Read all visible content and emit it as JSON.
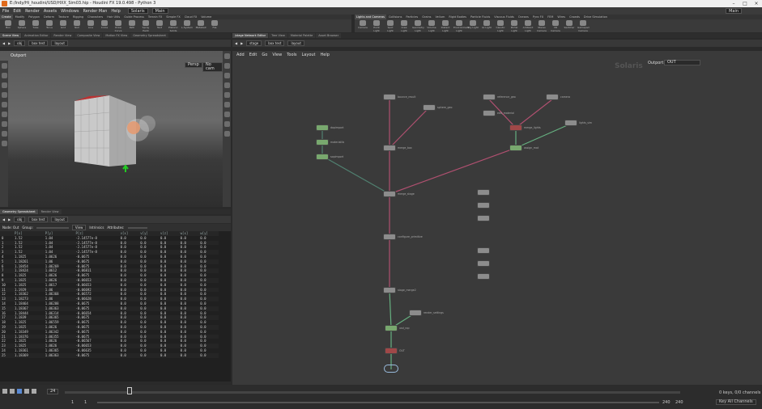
{
  "window": {
    "title": "E:/Indy/Hi_houdini/USD/HXX_Sim03.hip - Houdini FX 19.0.498 - Python 3"
  },
  "menu": [
    "File",
    "Edit",
    "Render",
    "Assets",
    "Windows",
    "Render Man",
    "Help"
  ],
  "desktop": {
    "left": "Solaris",
    "workspace": "Main",
    "right": "Main"
  },
  "shelf_tabs_left": [
    "Create",
    "Modify",
    "Polygon",
    "Deform",
    "Texture",
    "Rigging",
    "Characters",
    "Hair Utils",
    "Guide Process",
    "Terrain FX",
    "Simple FX",
    "Cloud FX",
    "Volume"
  ],
  "shelf_tabs_right": [
    "Lights and Cameras",
    "Collisions",
    "Particles",
    "Grains",
    "Vellum",
    "Rigid Bodies",
    "Particle Fluids",
    "Viscous Fluids",
    "Oceans",
    "Pyro FX",
    "FEM",
    "Wires",
    "Crowds",
    "Drive Simulation"
  ],
  "tools_left": [
    "Box",
    "Sphere",
    "Tube",
    "Torus",
    "Grid",
    "Null",
    "Line",
    "Circle",
    "Draw Curve",
    "Path",
    "Spray Paint",
    "Text",
    "Platonic Solids",
    "L-System",
    "Metaball",
    "File"
  ],
  "tools_right": [
    "Camera",
    "Point Light",
    "Spot Light",
    "Area Light",
    "Geometry Light",
    "Volume Light",
    "Distant Light",
    "Environment Light",
    "Sky Light",
    "GI Light",
    "Caustic Light",
    "Portal Light",
    "Ambient Light",
    "Stereo Camera",
    "VR Camera",
    "Switcher",
    "Gamepad Camera"
  ],
  "left_pane_tabs": [
    "Scene View",
    "Animation Editor",
    "Render View",
    "Composite View",
    "Motion FX View",
    "Geometry Spreadsheet"
  ],
  "left_path": [
    "obj",
    "box test",
    "layout"
  ],
  "viewport": {
    "label": "Outport",
    "persp": "Persp",
    "cam": "No cam"
  },
  "ss_tabs": [
    "Geometry Spreadsheet",
    "Render View"
  ],
  "ss_path": [
    "obj",
    "box test",
    "layout"
  ],
  "ss_toolbar": {
    "node": "Node: Out",
    "group": "Group:",
    "view": "View",
    "intrinsics": "Intrinsics",
    "attributes": "Attributes:"
  },
  "ss_columns": [
    "",
    "P[x]",
    "P[y]",
    "P[z]",
    "v[x]",
    "v[y]",
    "v[z]",
    "w[x]",
    "w[y]"
  ],
  "ss_rows": [
    [
      "0",
      "1.52",
      "1.04",
      "-2.14577e-8",
      "0.0",
      "0.0",
      "0.0",
      "0.0",
      "0.0"
    ],
    [
      "1",
      "1.52",
      "1.04",
      "-2.14577e-8",
      "0.0",
      "0.0",
      "0.0",
      "0.0",
      "0.0"
    ],
    [
      "2",
      "1.52",
      "1.04",
      "-2.14577e-8",
      "0.0",
      "0.0",
      "0.0",
      "0.0",
      "0.0"
    ],
    [
      "3",
      "1.52",
      "1.04",
      "-2.14577e-8",
      "0.0",
      "0.0",
      "0.0",
      "0.0",
      "0.0"
    ],
    [
      "4",
      "1.1825",
      "1.0626",
      "-0.0675",
      "0.0",
      "0.0",
      "0.0",
      "0.0",
      "0.0"
    ],
    [
      "5",
      "1.18261",
      "1.06",
      "-0.0675",
      "0.0",
      "0.0",
      "0.0",
      "0.0",
      "0.0"
    ],
    [
      "6",
      "1.18454",
      "1.06269",
      "-0.0675",
      "0.0",
      "0.0",
      "0.0",
      "0.0",
      "0.0"
    ],
    [
      "7",
      "1.18424",
      "1.0612",
      "-0.06811",
      "0.0",
      "0.0",
      "0.0",
      "0.0",
      "0.0"
    ],
    [
      "8",
      "1.1825",
      "1.0626",
      "-0.0675",
      "0.0",
      "0.0",
      "0.0",
      "0.0",
      "0.0"
    ],
    [
      "9",
      "1.1825",
      "1.0626",
      "-0.06653",
      "0.0",
      "0.0",
      "0.0",
      "0.0",
      "0.0"
    ],
    [
      "10",
      "1.1825",
      "1.0617",
      "-0.06653",
      "0.0",
      "0.0",
      "0.0",
      "0.0",
      "0.0"
    ],
    [
      "11",
      "1.1929",
      "1.06",
      "-0.06692",
      "0.0",
      "0.0",
      "0.0",
      "0.0",
      "0.0"
    ],
    [
      "12",
      "1.18362",
      "1.06368",
      "-0.06572",
      "0.0",
      "0.0",
      "0.0",
      "0.0",
      "0.0"
    ],
    [
      "13",
      "1.18273",
      "1.06",
      "-0.06628",
      "0.0",
      "0.0",
      "0.0",
      "0.0",
      "0.0"
    ],
    [
      "14",
      "1.18464",
      "1.06288",
      "-0.0675",
      "0.0",
      "0.0",
      "0.0",
      "0.0",
      "0.0"
    ],
    [
      "15",
      "1.18367",
      "1.06363",
      "-0.0675",
      "0.0",
      "0.0",
      "0.0",
      "0.0",
      "0.0"
    ],
    [
      "16",
      "1.18444",
      "1.06314",
      "-0.06654",
      "0.0",
      "0.0",
      "0.0",
      "0.0",
      "0.0"
    ],
    [
      "17",
      "1.1839",
      "1.06365",
      "-0.0675",
      "0.0",
      "0.0",
      "0.0",
      "0.0",
      "0.0"
    ],
    [
      "18",
      "1.1825",
      "1.06559",
      "-0.0675",
      "0.0",
      "0.0",
      "0.0",
      "0.0",
      "0.0"
    ],
    [
      "19",
      "1.1825",
      "1.0626",
      "-0.0675",
      "0.0",
      "0.0",
      "0.0",
      "0.0",
      "0.0"
    ],
    [
      "20",
      "1.18349",
      "1.06342",
      "-0.0675",
      "0.0",
      "0.0",
      "0.0",
      "0.0",
      "0.0"
    ],
    [
      "21",
      "1.18376",
      "1.06355",
      "-0.0675",
      "0.0",
      "0.0",
      "0.0",
      "0.0",
      "0.0"
    ],
    [
      "22",
      "1.1825",
      "1.0626",
      "-0.06567",
      "0.0",
      "0.0",
      "0.0",
      "0.0",
      "0.0"
    ],
    [
      "23",
      "1.1825",
      "1.0626",
      "-0.06653",
      "0.0",
      "0.0",
      "0.0",
      "0.0",
      "0.0"
    ],
    [
      "24",
      "1.18361",
      "1.06365",
      "-0.06635",
      "0.0",
      "0.0",
      "0.0",
      "0.0",
      "0.0"
    ],
    [
      "25",
      "1.18369",
      "1.06363",
      "-0.0675",
      "0.0",
      "0.0",
      "0.0",
      "0.0",
      "0.0"
    ]
  ],
  "net_tabs": [
    "/stage Network Editor",
    "Tree View",
    "Material Palette",
    "Asset Browser"
  ],
  "net_path": [
    "stage",
    "box test",
    "layout"
  ],
  "net_menu": [
    "Add",
    "Edit",
    "Go",
    "View",
    "Tools",
    "Layout",
    "Help"
  ],
  "net_watermark": "Solaris",
  "net_header": {
    "outport": "Outport",
    "out": "OUT"
  },
  "nodes": [
    {
      "label": "bounce_result"
    },
    {
      "label": "sphere_geo"
    },
    {
      "label": "reference_geo"
    },
    {
      "label": "edit_material"
    },
    {
      "label": "camera"
    },
    {
      "label": "lights_sim"
    },
    {
      "label": "dopimport"
    },
    {
      "label": "materiallib"
    },
    {
      "label": "merge_box"
    },
    {
      "label": "merge_lights"
    },
    {
      "label": "assign_mat"
    },
    {
      "label": "sopimport"
    },
    {
      "label": "merge_stage"
    },
    {
      "label": "configure_primitive"
    },
    {
      "label": "stage_merge2"
    },
    {
      "label": "render_settings"
    },
    {
      "label": "usd_rop"
    },
    {
      "label": "OUT"
    }
  ],
  "playbar": {
    "frame": "24",
    "start": "1",
    "end": "1",
    "range_end": "240",
    "range_end2": "240",
    "keys": "0 keys, 0/0 channels",
    "channels": "Key All Channels"
  },
  "accent": "#e06a1b"
}
